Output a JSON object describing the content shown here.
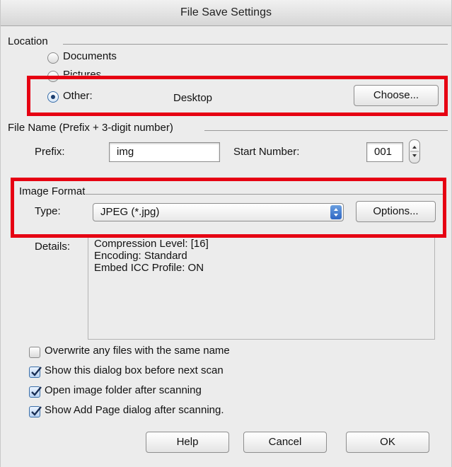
{
  "window": {
    "title": "File Save Settings"
  },
  "location": {
    "label": "Location",
    "options": [
      {
        "label": "Documents",
        "selected": false
      },
      {
        "label": "Pictures",
        "selected": false
      },
      {
        "label": "Other:",
        "selected": true
      }
    ],
    "other_path": "Desktop",
    "choose_label": "Choose..."
  },
  "file_name": {
    "label": "File Name (Prefix + 3-digit number)",
    "prefix_label": "Prefix:",
    "prefix_value": "img",
    "start_label": "Start Number:",
    "start_value": "001"
  },
  "image_format": {
    "label": "Image Format",
    "type_label": "Type:",
    "type_value": "JPEG (*.jpg)",
    "options_label": "Options...",
    "details_label": "Details:",
    "details_lines": [
      "Compression Level: [16]",
      "Encoding: Standard",
      "Embed ICC Profile: ON"
    ]
  },
  "checkboxes": [
    {
      "label": "Overwrite any files with the same name",
      "checked": false
    },
    {
      "label": "Show this dialog box before next scan",
      "checked": true
    },
    {
      "label": "Open image folder after scanning",
      "checked": true
    },
    {
      "label": "Show Add Page dialog after scanning.",
      "checked": true
    }
  ],
  "buttons": {
    "help": "Help",
    "cancel": "Cancel",
    "ok": "OK"
  },
  "colors": {
    "highlight": "#e60012",
    "dialog_bg": "#ececec",
    "accent": "#2e66c4"
  },
  "icons": {
    "select_arrow": "up-down-arrows-icon",
    "stepper": "up-down-stepper-icon",
    "check": "checkmark-icon"
  }
}
